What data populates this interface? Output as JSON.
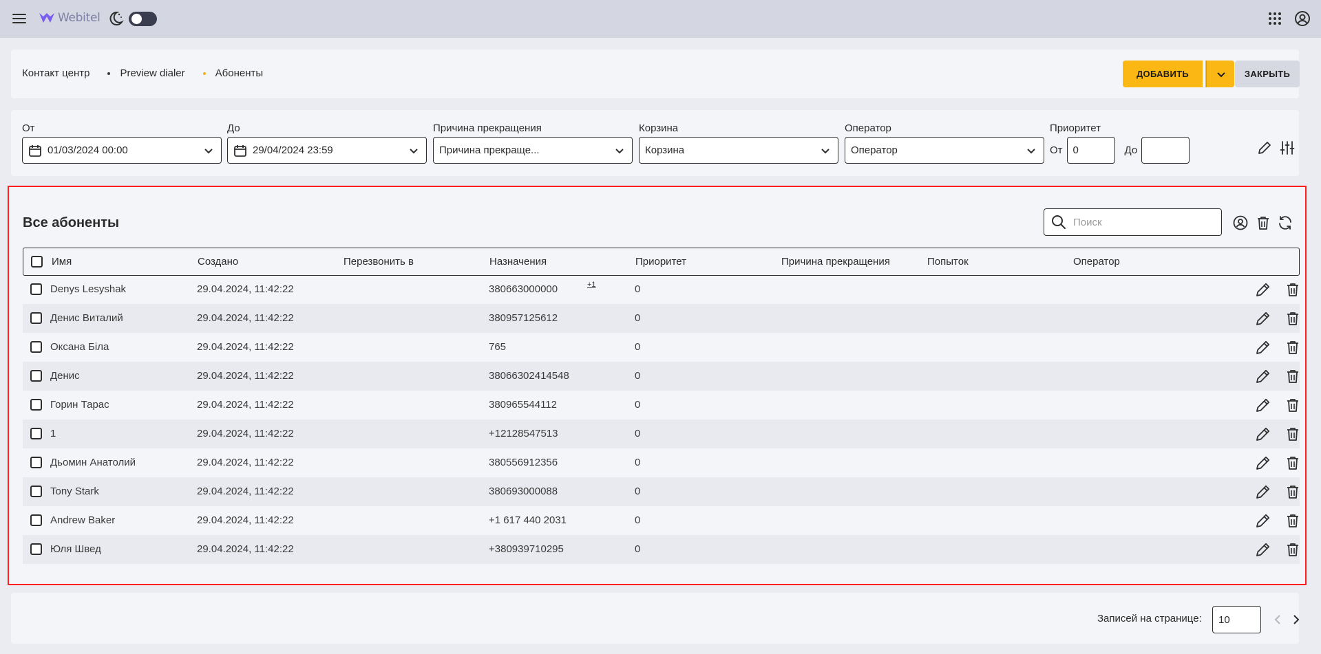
{
  "app": {
    "logo_text": "Webitel",
    "accent": "#fbb714"
  },
  "breadcrumb": [
    "Контакт центр",
    "Preview dialer",
    "Абоненты"
  ],
  "actions": {
    "add_label": "ДОБАВИТЬ",
    "close_label": "ЗАКРЫТЬ"
  },
  "filters": {
    "from": {
      "label": "От",
      "value": "01/03/2024 00:00"
    },
    "to": {
      "label": "До",
      "value": "29/04/2024 23:59"
    },
    "reason": {
      "label": "Причина прекращения",
      "value": "Причина прекраще..."
    },
    "bucket": {
      "label": "Корзина",
      "value": "Корзина"
    },
    "operator": {
      "label": "Оператор",
      "value": "Оператор"
    },
    "priority": {
      "label": "Приоритет",
      "from_label": "От",
      "from_value": "0",
      "to_label": "До",
      "to_value": ""
    }
  },
  "table": {
    "title": "Все абоненты",
    "search_placeholder": "Поиск",
    "columns": [
      "Имя",
      "Создано",
      "Перезвонить в",
      "Назначения",
      "Приоритет",
      "Причина прекращения",
      "Попыток",
      "Оператор"
    ],
    "rows": [
      {
        "name": "Denys Lesyshak",
        "created": "29.04.2024, 11:42:22",
        "destination": "380663000000",
        "extra": "+1",
        "priority": "0"
      },
      {
        "name": "Денис Виталий",
        "created": "29.04.2024, 11:42:22",
        "destination": "380957125612",
        "extra": "",
        "priority": "0"
      },
      {
        "name": "Оксана Біла",
        "created": "29.04.2024, 11:42:22",
        "destination": "765",
        "extra": "",
        "priority": "0"
      },
      {
        "name": "Денис",
        "created": "29.04.2024, 11:42:22",
        "destination": "38066302414548",
        "extra": "",
        "priority": "0"
      },
      {
        "name": "Горин Тарас",
        "created": "29.04.2024, 11:42:22",
        "destination": "380965544112",
        "extra": "",
        "priority": "0"
      },
      {
        "name": "1",
        "created": "29.04.2024, 11:42:22",
        "destination": "+12128547513",
        "extra": "",
        "priority": "0"
      },
      {
        "name": "Дьомин Анатолий",
        "created": "29.04.2024, 11:42:22",
        "destination": "380556912356",
        "extra": "",
        "priority": "0"
      },
      {
        "name": "Tony Stark",
        "created": "29.04.2024, 11:42:22",
        "destination": "380693000088",
        "extra": "",
        "priority": "0"
      },
      {
        "name": "Andrew Baker",
        "created": "29.04.2024, 11:42:22",
        "destination": "+1 617 440 2031",
        "extra": "",
        "priority": "0"
      },
      {
        "name": "Юля Швед",
        "created": "29.04.2024, 11:42:22",
        "destination": "+380939710295",
        "extra": "",
        "priority": "0"
      }
    ]
  },
  "pagination": {
    "label": "Записей на странице:",
    "per_page": "10"
  }
}
